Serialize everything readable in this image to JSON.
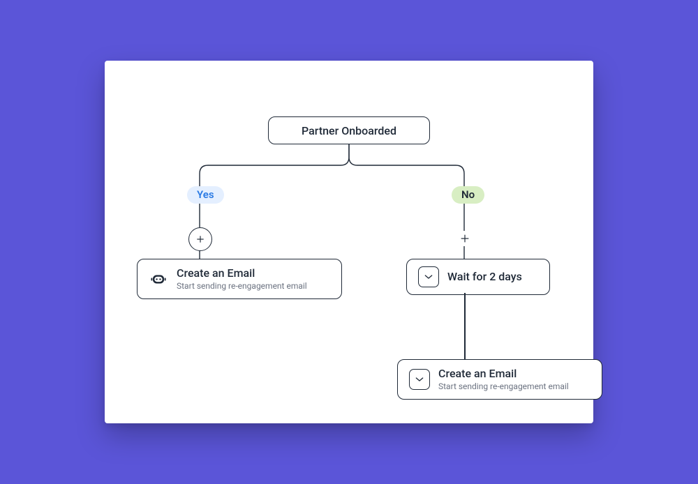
{
  "root": {
    "label": "Partner Onboarded"
  },
  "branches": {
    "yes": {
      "label": "Yes"
    },
    "no": {
      "label": "No"
    }
  },
  "nodes": {
    "email_left": {
      "title": "Create an Email",
      "subtitle": "Start sending re-engagement email"
    },
    "wait": {
      "title": "Wait for 2 days"
    },
    "email_right": {
      "title": "Create an Email",
      "subtitle": "Start sending re-engagement email"
    }
  },
  "icons": {
    "plus": "plus-icon",
    "envelope_bot": "bot-email-icon",
    "envelope": "envelope-icon"
  }
}
